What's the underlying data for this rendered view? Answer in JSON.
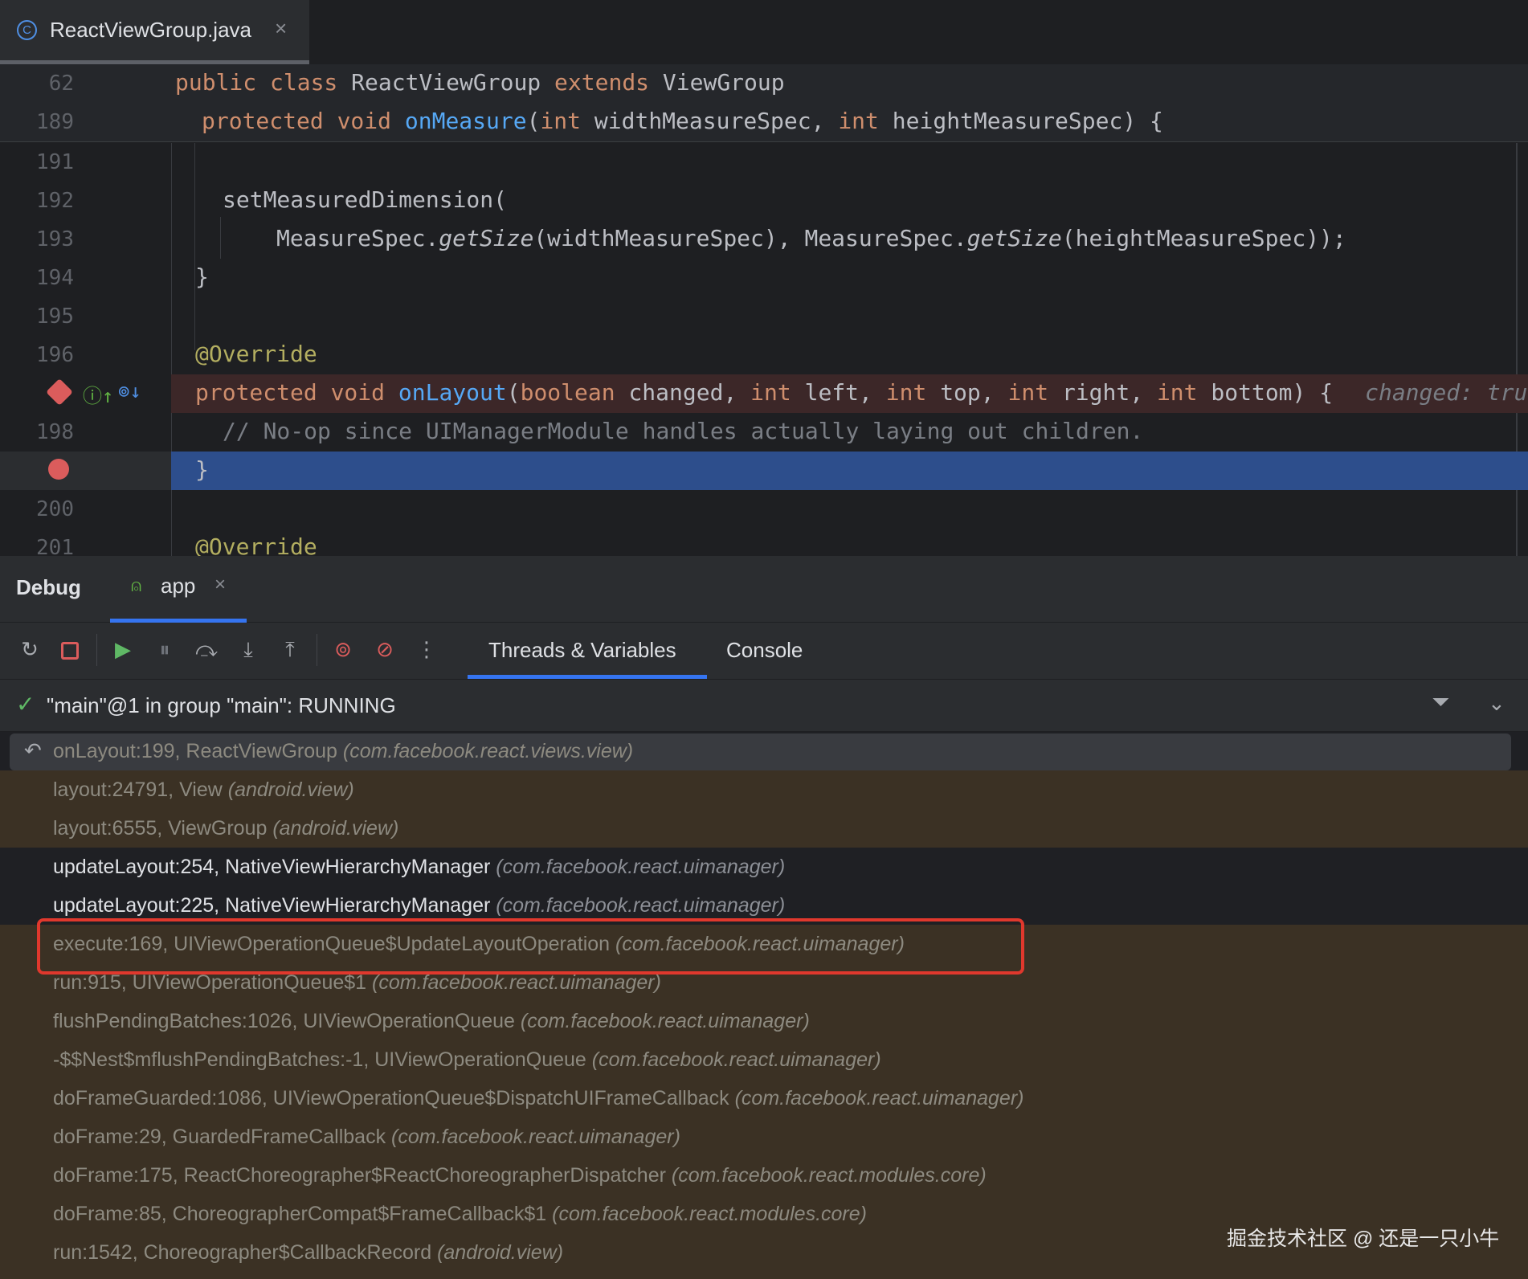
{
  "tab": {
    "filename": "ReactViewGroup.java",
    "close": "×"
  },
  "editor": {
    "sticky": [
      {
        "num": "62",
        "tokens": [
          [
            "kw",
            "public class "
          ],
          [
            "",
            "ReactViewGroup "
          ],
          [
            "kw",
            "extends "
          ],
          [
            "",
            "ViewGroup"
          ]
        ]
      },
      {
        "num": "189",
        "tokens": [
          [
            "kw",
            "protected void "
          ],
          [
            "fn",
            "onMeasure"
          ],
          [
            "",
            "("
          ],
          [
            "kw",
            "int "
          ],
          [
            "",
            "widthMeasureSpec, "
          ],
          [
            "kw",
            "int "
          ],
          [
            "",
            "heightMeasureSpec) {"
          ]
        ]
      }
    ],
    "lines": [
      {
        "num": "191",
        "tokens": []
      },
      {
        "num": "192",
        "tokens": [
          [
            "",
            "setMeasuredDimension("
          ]
        ]
      },
      {
        "num": "193",
        "tokens": [
          [
            "",
            "MeasureSpec."
          ],
          [
            "it",
            "getSize"
          ],
          [
            "",
            "(widthMeasureSpec), MeasureSpec."
          ],
          [
            "it",
            "getSize"
          ],
          [
            "",
            "(heightMeasureSpec));"
          ]
        ]
      },
      {
        "num": "194",
        "tokens": [
          [
            "",
            "}"
          ]
        ]
      },
      {
        "num": "195",
        "tokens": []
      },
      {
        "num": "196",
        "tokens": [
          [
            "ann",
            "@Override"
          ]
        ]
      },
      {
        "num": "",
        "tokens": [
          [
            "kw",
            "protected void "
          ],
          [
            "fn",
            "onLayout"
          ],
          [
            "",
            "("
          ],
          [
            "kw",
            "boolean "
          ],
          [
            "",
            "changed, "
          ],
          [
            "kw",
            "int "
          ],
          [
            "",
            "left, "
          ],
          [
            "kw",
            "int "
          ],
          [
            "",
            "top, "
          ],
          [
            "kw",
            "int "
          ],
          [
            "",
            "right, "
          ],
          [
            "kw",
            "int "
          ],
          [
            "",
            "bottom) {"
          ]
        ],
        "inlay": "changed: true"
      },
      {
        "num": "198",
        "tokens": [
          [
            "cmt",
            "// No-op since UIManagerModule handles actually laying out children."
          ]
        ]
      },
      {
        "num": "",
        "tokens": [
          [
            "",
            "}"
          ]
        ]
      },
      {
        "num": "200",
        "tokens": []
      },
      {
        "num": "201",
        "tokens": [
          [
            "ann",
            "@Override"
          ]
        ]
      }
    ]
  },
  "debug": {
    "title": "Debug",
    "session_tab": "app",
    "session_close": "×",
    "tabs": {
      "threads": "Threads & Variables",
      "console": "Console"
    },
    "thread_status": "\"main\"@1 in group \"main\": RUNNING",
    "frames": [
      {
        "method": "onLayout:199, ReactViewGroup ",
        "pkg": "(com.facebook.react.views.view)",
        "kind": "selected"
      },
      {
        "method": "layout:24791, View ",
        "pkg": "(android.view)",
        "kind": "lib"
      },
      {
        "method": "layout:6555, ViewGroup ",
        "pkg": "(android.view)",
        "kind": "lib"
      },
      {
        "method": "updateLayout:254, NativeViewHierarchyManager ",
        "pkg": "(com.facebook.react.uimanager)",
        "kind": "user"
      },
      {
        "method": "updateLayout:225, NativeViewHierarchyManager ",
        "pkg": "(com.facebook.react.uimanager)",
        "kind": "user"
      },
      {
        "method": "execute:169, UIViewOperationQueue$UpdateLayoutOperation ",
        "pkg": "(com.facebook.react.uimanager)",
        "kind": "lib"
      },
      {
        "method": "run:915, UIViewOperationQueue$1 ",
        "pkg": "(com.facebook.react.uimanager)",
        "kind": "lib"
      },
      {
        "method": "flushPendingBatches:1026, UIViewOperationQueue ",
        "pkg": "(com.facebook.react.uimanager)",
        "kind": "lib"
      },
      {
        "method": "-$$Nest$mflushPendingBatches:-1, UIViewOperationQueue ",
        "pkg": "(com.facebook.react.uimanager)",
        "kind": "lib"
      },
      {
        "method": "doFrameGuarded:1086, UIViewOperationQueue$DispatchUIFrameCallback ",
        "pkg": "(com.facebook.react.uimanager)",
        "kind": "lib"
      },
      {
        "method": "doFrame:29, GuardedFrameCallback ",
        "pkg": "(com.facebook.react.uimanager)",
        "kind": "lib"
      },
      {
        "method": "doFrame:175, ReactChoreographer$ReactChoreographerDispatcher ",
        "pkg": "(com.facebook.react.modules.core)",
        "kind": "lib"
      },
      {
        "method": "doFrame:85, ChoreographerCompat$FrameCallback$1 ",
        "pkg": "(com.facebook.react.modules.core)",
        "kind": "lib"
      },
      {
        "method": "run:1542, Choreographer$CallbackRecord ",
        "pkg": "(android.view)",
        "kind": "lib"
      }
    ]
  },
  "watermark": "掘金技术社区 @ 还是一只小牛",
  "icons": [
    "class-icon",
    "close-icon",
    "breakpoint-icon",
    "implements-icon",
    "overrides-icon",
    "android-icon",
    "rerun-icon",
    "stop-icon",
    "resume-icon",
    "pause-icon",
    "step-over-icon",
    "step-into-icon",
    "step-out-icon",
    "view-breakpoints-icon",
    "mute-breakpoints-icon",
    "more-icon",
    "check-icon",
    "filter-icon",
    "chevron-down-icon",
    "return-frame-icon"
  ],
  "colors": {
    "accent": "#3574f0",
    "current_line": "#2d4e8c",
    "breakpoint": "#db5c5c",
    "library_frames": "#3b3124",
    "highlight_box": "#e0382d"
  }
}
